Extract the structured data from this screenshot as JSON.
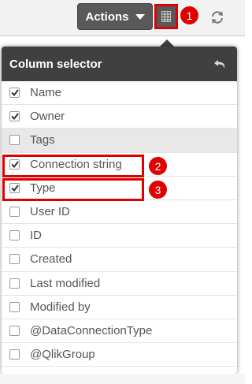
{
  "toolbar": {
    "actions_label": "Actions",
    "column_selector_icon": "table-columns-icon",
    "reload_icon": "reload-icon"
  },
  "annotations": [
    "1",
    "2",
    "3"
  ],
  "popup": {
    "title": "Column selector",
    "back_icon": "undo-arrow-icon",
    "columns": [
      {
        "label": "Name",
        "checked": true
      },
      {
        "label": "Owner",
        "checked": true
      },
      {
        "label": "Tags",
        "checked": false
      },
      {
        "label": "Connection string",
        "checked": true
      },
      {
        "label": "Type",
        "checked": true
      },
      {
        "label": "User ID",
        "checked": false
      },
      {
        "label": "ID",
        "checked": false
      },
      {
        "label": "Created",
        "checked": false
      },
      {
        "label": "Last modified",
        "checked": false
      },
      {
        "label": "Modified by",
        "checked": false
      },
      {
        "label": "@DataConnectionType",
        "checked": false
      },
      {
        "label": "@QlikGroup",
        "checked": false
      }
    ]
  },
  "colors": {
    "header_bg": "#404040",
    "button_bg": "#595959",
    "annotation_red": "#e00000",
    "hover_row_bg": "#e8e8e8"
  }
}
